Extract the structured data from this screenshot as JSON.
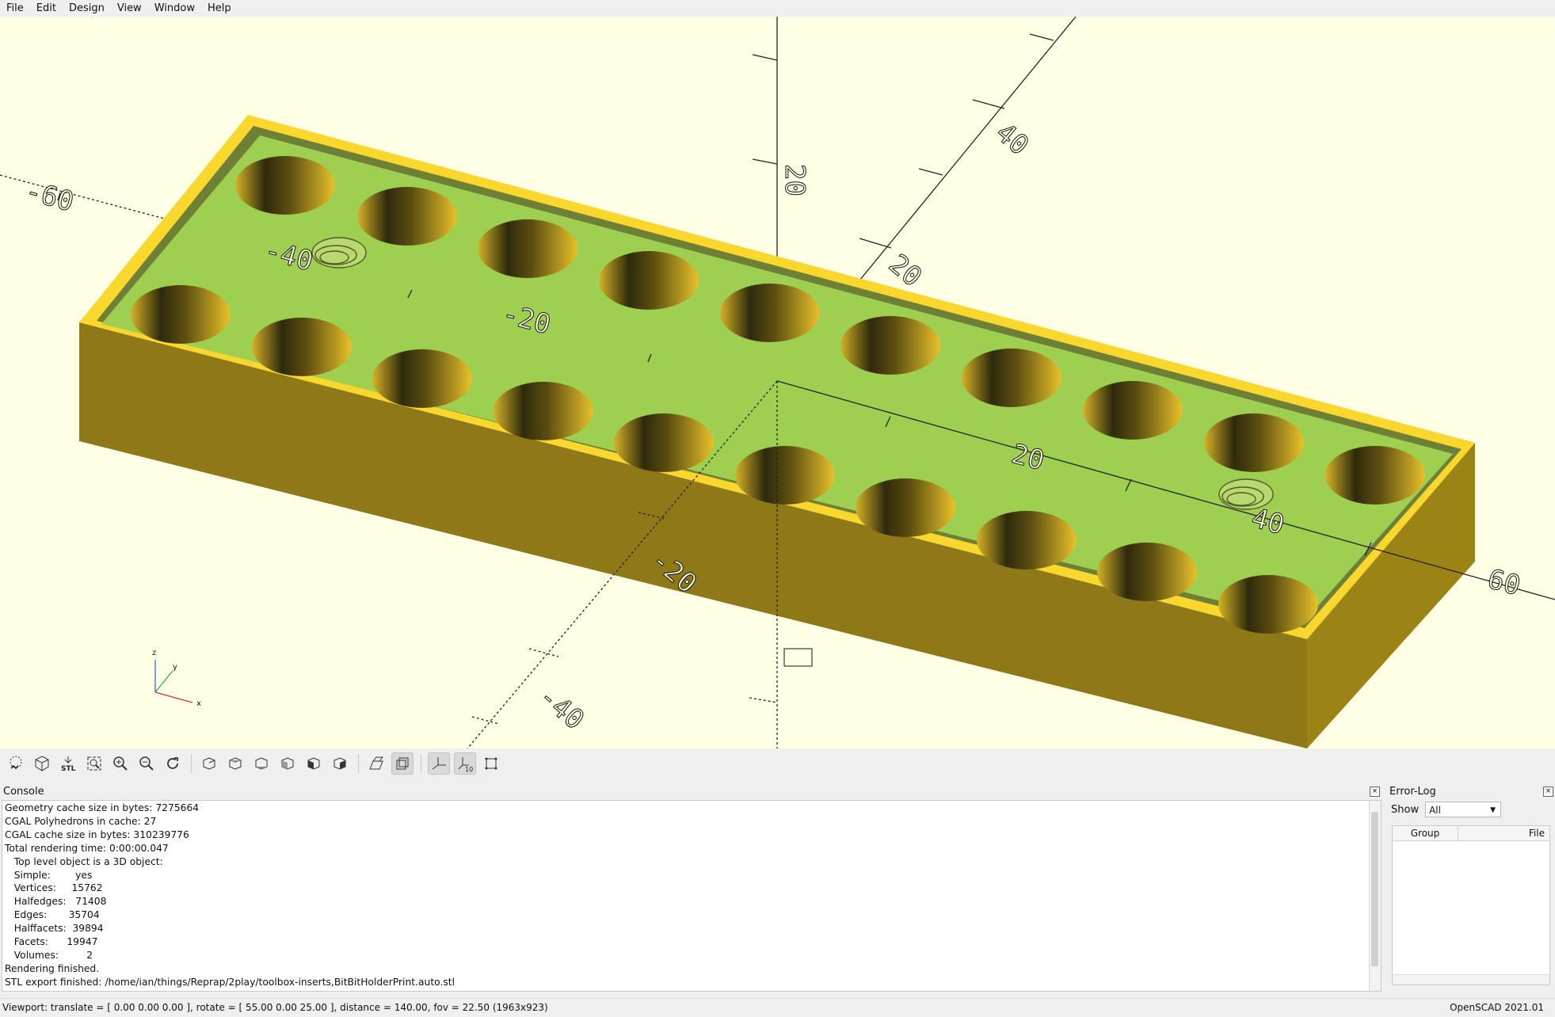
{
  "menu": [
    "File",
    "Edit",
    "Design",
    "View",
    "Window",
    "Help"
  ],
  "viewport": {
    "axis_ticks": [
      "-60",
      "-40",
      "-20",
      "20",
      "40",
      "60",
      "20",
      "40",
      "20",
      "-20",
      "-40"
    ],
    "orientation_axes": [
      "x",
      "y",
      "z"
    ],
    "colors": {
      "background": "#ffffe5",
      "model_face": "#f9d72c",
      "model_side": "#9c7f16",
      "top_surface": "#9fcf51"
    }
  },
  "toolbar": {
    "buttons": [
      "preview",
      "render",
      "export-stl",
      "view-all",
      "zoom-in",
      "zoom-out",
      "reset-view",
      "view-right",
      "view-top",
      "view-bottom",
      "view-left",
      "view-front",
      "view-back",
      "perspective",
      "orthogonal",
      "show-axes",
      "show-scale-markers",
      "show-edges"
    ],
    "stl_label": "STL",
    "scale_label": "10"
  },
  "console": {
    "title": "Console",
    "lines": [
      "Geometry cache size in bytes: 7275664",
      "CGAL Polyhedrons in cache: 27",
      "CGAL cache size in bytes: 310239776",
      "Total rendering time: 0:00:00.047",
      "   Top level object is a 3D object:",
      "   Simple:        yes",
      "   Vertices:     15762",
      "   Halfedges:   71408",
      "   Edges:       35704",
      "   Halffacets:  39894",
      "   Facets:      19947",
      "   Volumes:         2",
      "Rendering finished.",
      "STL export finished: /home/ian/things/Reprap/2play/toolbox-inserts,BitBitHolderPrint.auto.stl"
    ]
  },
  "error_log": {
    "title": "Error-Log",
    "show_label": "Show",
    "show_value": "All",
    "columns": [
      "Group",
      "File"
    ]
  },
  "status": {
    "viewport": "Viewport: translate = [ 0.00 0.00 0.00 ], rotate = [ 55.00 0.00 25.00 ], distance = 140.00, fov = 22.50 (1963x923)",
    "version": "OpenSCAD 2021.01"
  }
}
